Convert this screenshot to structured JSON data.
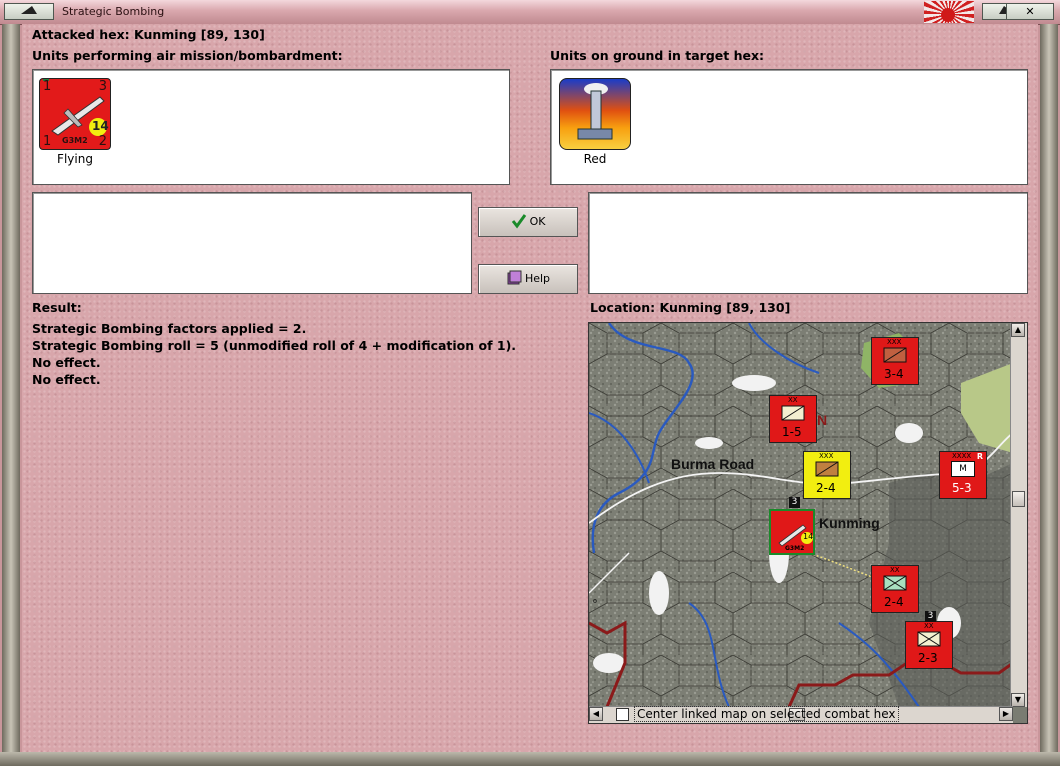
{
  "window": {
    "title": "Strategic Bombing",
    "close_glyph": "✕"
  },
  "attacked_hex": "Attacked hex: Kunming  [89, 130]",
  "air_panel": {
    "heading": "Units performing air mission/bombardment:",
    "unit": {
      "type_label": "G3M2",
      "tl": "1",
      "tr": "3",
      "bl": "1",
      "br": "2",
      "badge": "14",
      "status": "Flying"
    }
  },
  "ground_panel": {
    "heading": "Units on ground in target hex:",
    "unit": {
      "caption": "Red"
    }
  },
  "buttons": {
    "ok": "OK",
    "help": "Help"
  },
  "result": {
    "heading": "Result:",
    "lines": [
      "Strategic Bombing factors applied = 2.",
      "Strategic Bombing roll = 5 (unmodified roll of 4 + modification of 1).",
      "No effect.",
      "No effect."
    ]
  },
  "location": "Location:  Kunming  [89, 130]",
  "map": {
    "labels": {
      "road": "Burma Road",
      "city": "Kunming",
      "partial": "N"
    },
    "counters": [
      {
        "size": "XXX",
        "strength": "3-4",
        "color": "#e01818",
        "symbol": "armor"
      },
      {
        "size": "XX",
        "strength": "1-5",
        "color": "#e01818",
        "symbol": "infantry"
      },
      {
        "size": "XXX",
        "strength": "2-4",
        "color": "#f2ee10",
        "symbol": "armor"
      },
      {
        "size": "XXXX",
        "strength": "5-3",
        "color": "#e01818",
        "symbol": "mech",
        "flag": "R",
        "mark": "M"
      },
      {
        "size": "XX",
        "strength": "2-4",
        "color": "#e01818",
        "symbol": "mountain"
      },
      {
        "size": "XX",
        "strength": "2-3",
        "color": "#e01818",
        "symbol": "infantry"
      }
    ],
    "air_counter": {
      "type_label": "G3M2",
      "badge": "14",
      "stack": "3"
    },
    "stack_marker": "3"
  },
  "center_checkbox": {
    "label": "Center linked map on selected combat hex",
    "checked": false
  },
  "colors": {
    "dialog_bg": "#d8a6ab",
    "unit_red": "#e01818",
    "unit_yellow": "#f2ee10"
  }
}
